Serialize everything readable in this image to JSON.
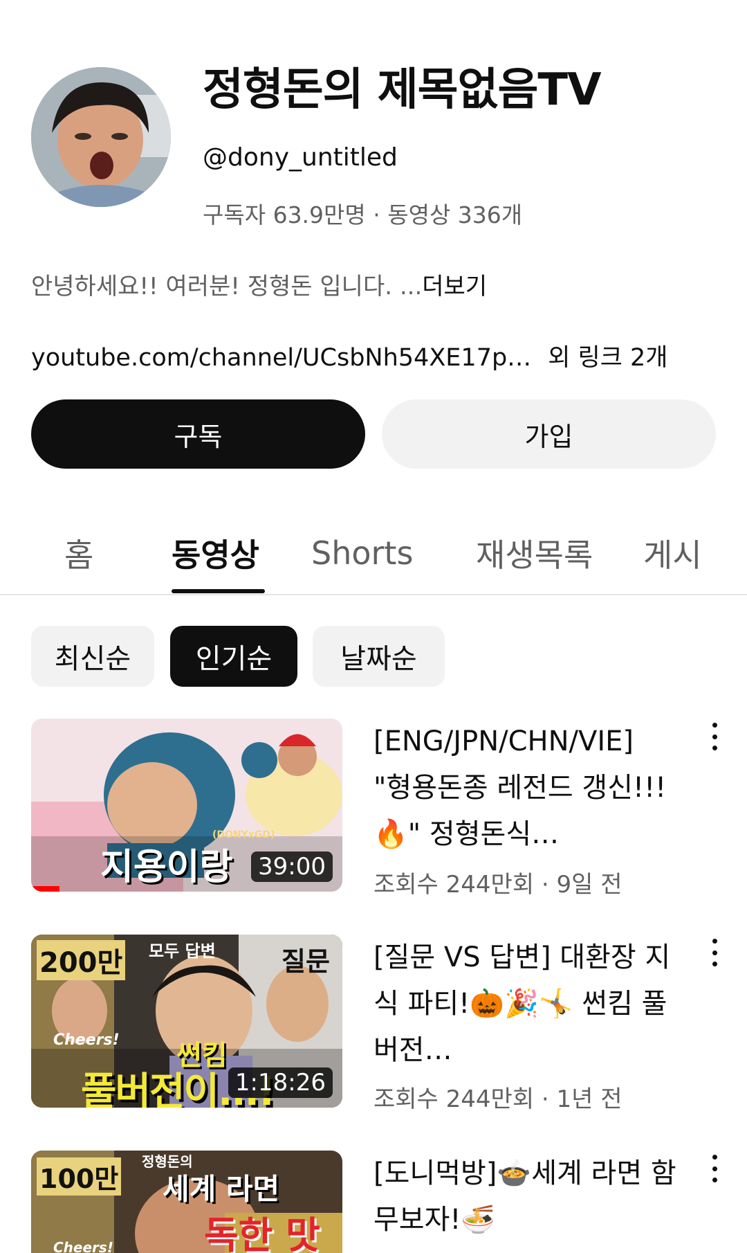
{
  "channel": {
    "title": "정형돈의 제목없음TV",
    "handle": "@dony_untitled",
    "stats": "구독자 63.9만명 · 동영상 336개",
    "description": "안녕하세요!! 여러분! 정형돈 입니다. ...",
    "description_more": "더보기",
    "link": "youtube.com/channel/UCsbNh54XE17p…",
    "link_extra": "외 링크 2개"
  },
  "buttons": {
    "subscribe": "구독",
    "join": "가입"
  },
  "tabs": [
    {
      "label": "홈",
      "active": false
    },
    {
      "label": "동영상",
      "active": true
    },
    {
      "label": "Shorts",
      "active": false
    },
    {
      "label": "재생목록",
      "active": false
    },
    {
      "label": "게시",
      "active": false
    }
  ],
  "chips": [
    {
      "label": "최신순",
      "active": false
    },
    {
      "label": "인기순",
      "active": true
    },
    {
      "label": "날짜순",
      "active": false
    }
  ],
  "videos": [
    {
      "title": "[ENG/JPN/CHN/VIE] \"형용돈종 레전드 갱신!!!🔥\" 정형돈식…",
      "meta": "조회수 244만회 · 9일 전",
      "duration": "39:00",
      "thumb_text": "지용이랑",
      "thumb_small": "(DONYxGD)",
      "watched_progress": 0.09
    },
    {
      "title": "[질문 VS 답변] 대환장 지식 파티!🎃🎉🤸 썬킴 풀버전…",
      "meta": "조회수 244만회 · 1년 전",
      "duration": "1:18:26",
      "thumb_badge": "200만",
      "thumb_top": "모두 답변",
      "thumb_right": "질문",
      "thumb_left": "Cheers!",
      "thumb_main1": "썬킴",
      "thumb_main2": "풀버전이...!"
    },
    {
      "title": "[도니먹방]🍲세계 라면 함 무보자!🍜",
      "meta": "",
      "duration": "",
      "thumb_badge": "100만",
      "thumb_top": "정형돈의",
      "thumb_main1": "세계 라면",
      "thumb_main2": "독한 맛",
      "thumb_left": "Cheers!"
    }
  ]
}
